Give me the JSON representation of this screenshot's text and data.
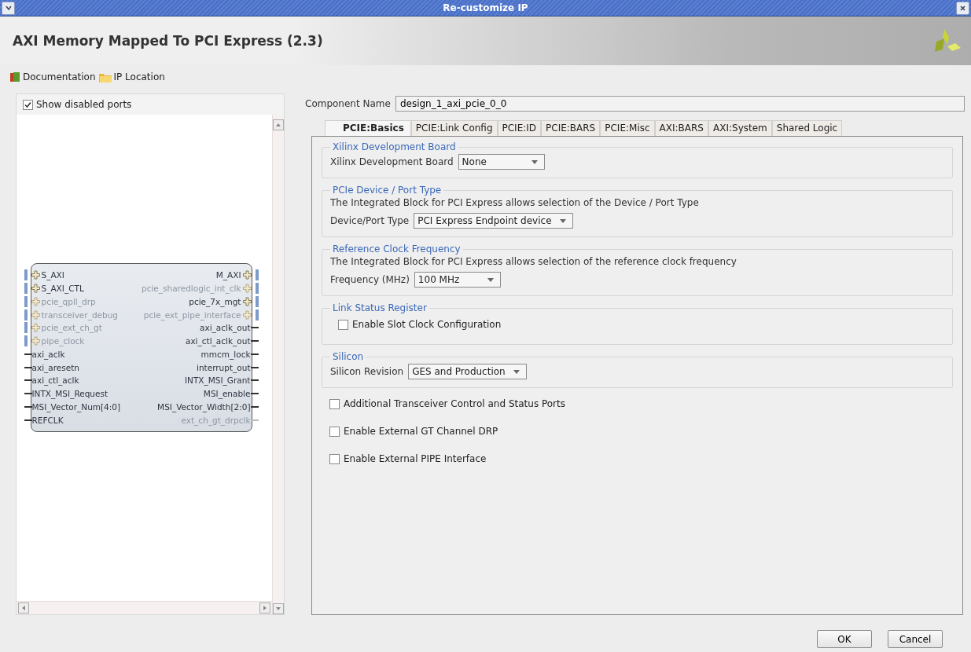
{
  "window": {
    "title": "Re-customize IP"
  },
  "header": {
    "title": "AXI Memory Mapped To PCI Express (2.3)"
  },
  "links": [
    {
      "kind": "book",
      "label": "Documentation"
    },
    {
      "kind": "folder",
      "label": "IP Location"
    }
  ],
  "symbol_panel": {
    "show_disabled_ports": {
      "label": "Show disabled ports",
      "checked": true
    },
    "left_ports": [
      {
        "name": "S_AXI",
        "kind": "bus",
        "disabled": false
      },
      {
        "name": "S_AXI_CTL",
        "kind": "bus",
        "disabled": false
      },
      {
        "name": "pcie_qpll_drp",
        "kind": "bus",
        "disabled": true
      },
      {
        "name": "transceiver_debug",
        "kind": "bus",
        "disabled": true
      },
      {
        "name": "pcie_ext_ch_gt",
        "kind": "bus",
        "disabled": true
      },
      {
        "name": "pipe_clock",
        "kind": "bus",
        "disabled": true
      },
      {
        "name": "axi_aclk",
        "kind": "wire",
        "disabled": false
      },
      {
        "name": "axi_aresetn",
        "kind": "wire",
        "disabled": false
      },
      {
        "name": "axi_ctl_aclk",
        "kind": "wire",
        "disabled": false
      },
      {
        "name": "INTX_MSI_Request",
        "kind": "wire",
        "disabled": false
      },
      {
        "name": "MSI_Vector_Num[4:0]",
        "kind": "wire",
        "disabled": false
      },
      {
        "name": "REFCLK",
        "kind": "wire",
        "disabled": false
      }
    ],
    "right_ports": [
      {
        "name": "M_AXI",
        "kind": "bus",
        "disabled": false
      },
      {
        "name": "pcie_sharedlogic_int_clk",
        "kind": "bus",
        "disabled": true
      },
      {
        "name": "pcie_7x_mgt",
        "kind": "bus",
        "disabled": false
      },
      {
        "name": "pcie_ext_pipe_interface",
        "kind": "bus",
        "disabled": true
      },
      {
        "name": "axi_aclk_out",
        "kind": "wire",
        "disabled": false
      },
      {
        "name": "axi_ctl_aclk_out",
        "kind": "wire",
        "disabled": false
      },
      {
        "name": "mmcm_lock",
        "kind": "wire",
        "disabled": false
      },
      {
        "name": "interrupt_out",
        "kind": "wire",
        "disabled": false
      },
      {
        "name": "INTX_MSI_Grant",
        "kind": "wire",
        "disabled": false
      },
      {
        "name": "MSI_enable",
        "kind": "wire",
        "disabled": false
      },
      {
        "name": "MSI_Vector_Width[2:0]",
        "kind": "wire",
        "disabled": false
      },
      {
        "name": "ext_ch_gt_drpclk",
        "kind": "wire",
        "disabled": true
      }
    ]
  },
  "component_name": {
    "label": "Component Name",
    "value": "design_1_axi_pcie_0_0"
  },
  "tabs": [
    {
      "label": "PCIE:Basics",
      "selected": true
    },
    {
      "label": "PCIE:Link Config",
      "selected": false
    },
    {
      "label": "PCIE:ID",
      "selected": false
    },
    {
      "label": "PCIE:BARS",
      "selected": false
    },
    {
      "label": "PCIE:Misc",
      "selected": false
    },
    {
      "label": "AXI:BARS",
      "selected": false
    },
    {
      "label": "AXI:System",
      "selected": false
    },
    {
      "label": "Shared Logic",
      "selected": false
    }
  ],
  "groups": [
    {
      "title": "Xilinx Development Board",
      "fields": [
        {
          "kind": "select",
          "label": "Xilinx Development Board",
          "value": "None"
        }
      ]
    },
    {
      "title": "PCIe Device / Port Type",
      "description": "The Integrated Block for PCI Express allows selection of the Device / Port Type",
      "fields": [
        {
          "kind": "select",
          "label": "Device/Port Type",
          "value": "PCI Express Endpoint device"
        }
      ]
    },
    {
      "title": "Reference Clock Frequency",
      "description": "The Integrated Block for PCI Express allows selection of the reference clock frequency",
      "fields": [
        {
          "kind": "select",
          "label": "Frequency (MHz)",
          "value": "100 MHz"
        }
      ]
    },
    {
      "title": "Link Status Register",
      "fields": [
        {
          "kind": "checkbox",
          "label": "Enable Slot Clock Configuration",
          "checked": false
        }
      ]
    },
    {
      "title": "Silicon",
      "fields": [
        {
          "kind": "select",
          "label": "Silicon Revision",
          "value": "GES and Production"
        }
      ]
    }
  ],
  "options": [
    {
      "label": "Additional Transceiver Control and Status Ports",
      "checked": false
    },
    {
      "label": "Enable External GT Channel DRP",
      "checked": false
    },
    {
      "label": "Enable External PIPE Interface",
      "checked": false
    }
  ],
  "buttons": [
    {
      "label": "OK"
    },
    {
      "label": "Cancel"
    }
  ]
}
